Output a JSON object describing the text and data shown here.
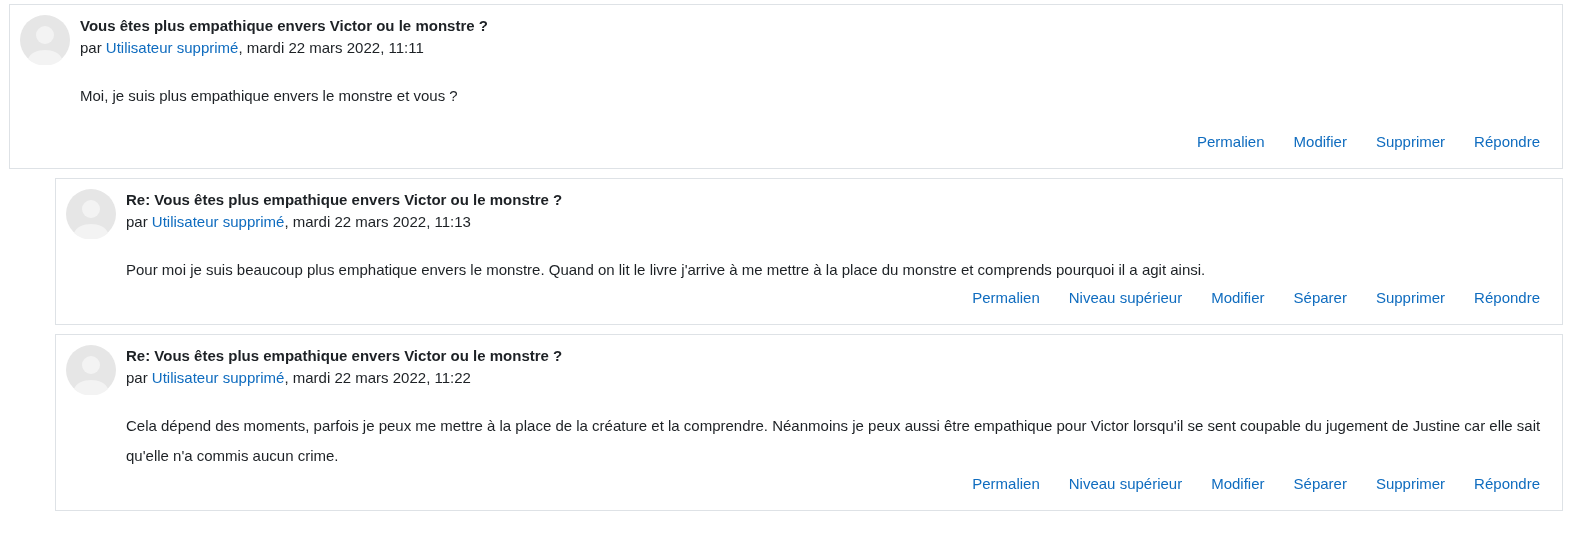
{
  "posts": [
    {
      "title": "Vous êtes plus empathique envers Victor ou le monstre ?",
      "by": "par",
      "author": "Utilisateur supprimé",
      "date": ", mardi 22 mars 2022, 11:11",
      "body": "Moi, je suis plus empathique envers le monstre et vous ?",
      "actions": [
        "Permalien",
        "Modifier",
        "Supprimer",
        "Répondre"
      ],
      "children": [
        {
          "title": "Re: Vous êtes plus empathique envers Victor ou le monstre ?",
          "by": "par",
          "author": "Utilisateur supprimé",
          "date": ", mardi 22 mars 2022, 11:13",
          "body": "Pour moi je suis beaucoup plus emphatique envers le monstre. Quand on lit le livre j'arrive à me mettre à la place du monstre et comprends pourquoi il a agit ainsi.",
          "actions": [
            "Permalien",
            "Niveau supérieur",
            "Modifier",
            "Séparer",
            "Supprimer",
            "Répondre"
          ]
        },
        {
          "title": "Re: Vous êtes plus empathique envers Victor ou le monstre ?",
          "by": "par",
          "author": "Utilisateur supprimé",
          "date": ", mardi 22 mars 2022, 11:22",
          "body": "Cela dépend des moments, parfois je peux me mettre à la place de la créature et la comprendre. Néanmoins je peux aussi être empathique pour Victor lorsqu'il se sent coupable du jugement de Justine car elle sait qu'elle n'a commis aucun crime.",
          "actions": [
            "Permalien",
            "Niveau supérieur",
            "Modifier",
            "Séparer",
            "Supprimer",
            "Répondre"
          ]
        }
      ]
    }
  ]
}
